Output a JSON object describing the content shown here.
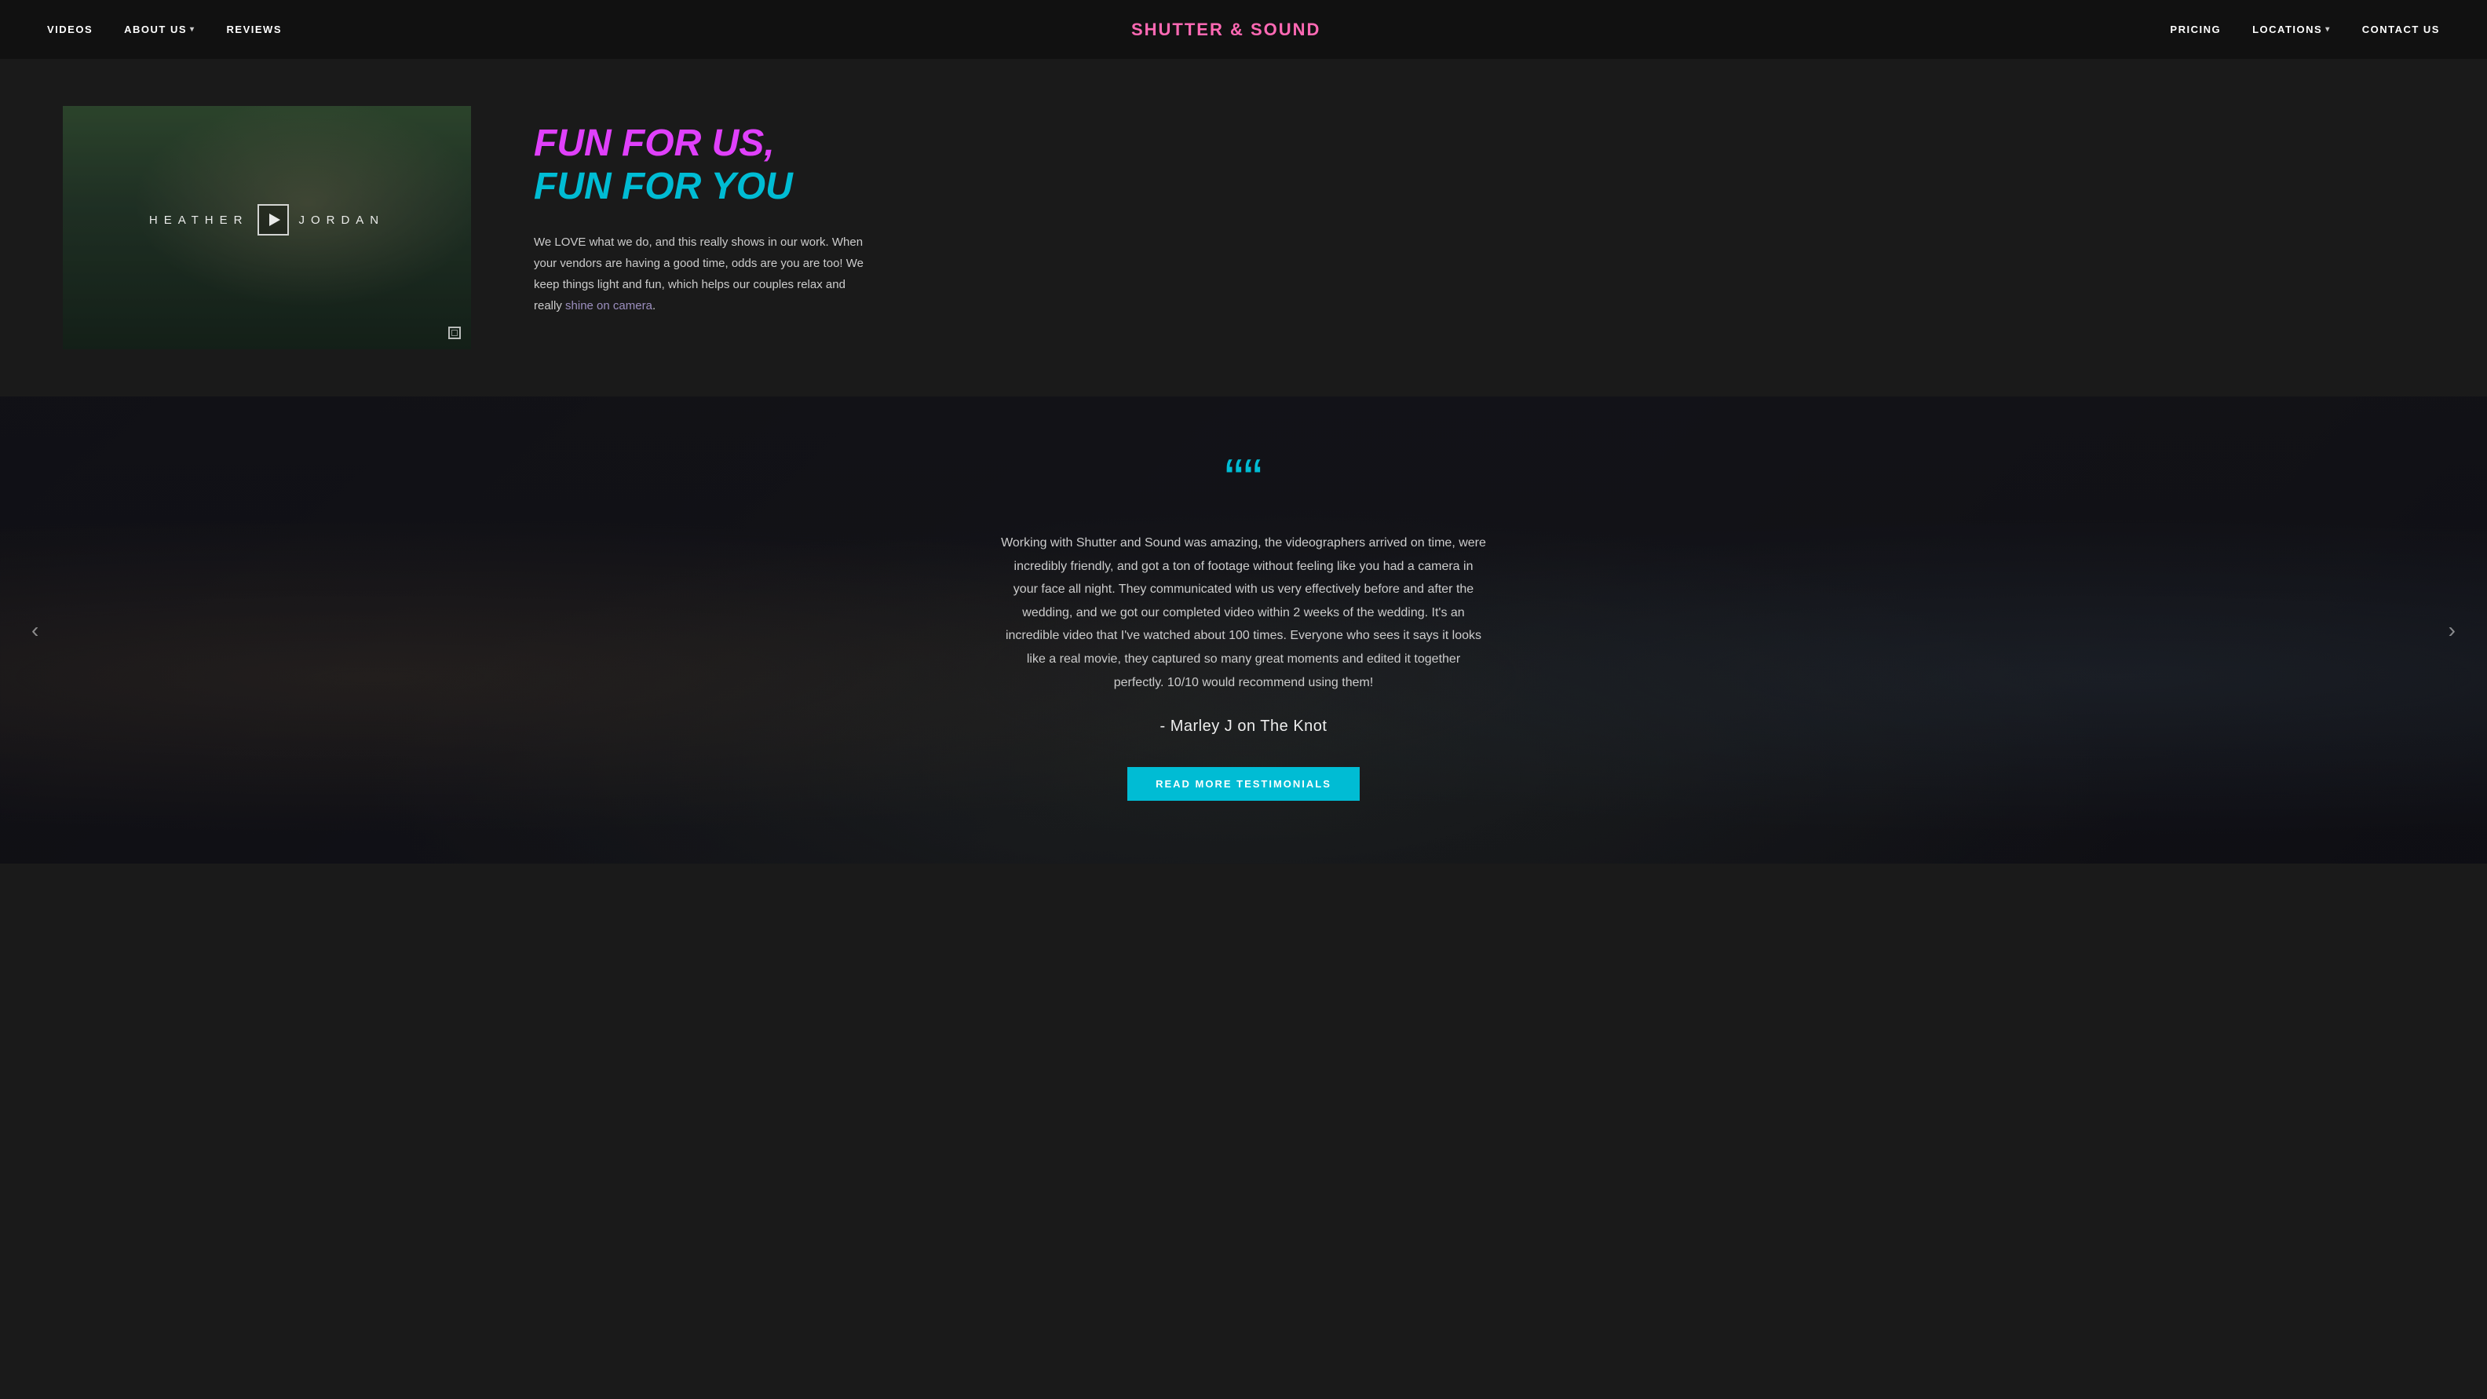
{
  "navbar": {
    "logo": {
      "part1": "SHUTTER",
      "amp": " & ",
      "part2": "SOUND"
    },
    "nav_left": [
      {
        "id": "videos",
        "label": "VIDEOS",
        "has_dropdown": false
      },
      {
        "id": "about",
        "label": "ABOUT US",
        "has_dropdown": true
      },
      {
        "id": "reviews",
        "label": "REVIEWS",
        "has_dropdown": false
      }
    ],
    "nav_right": [
      {
        "id": "pricing",
        "label": "PRICING",
        "has_dropdown": false
      },
      {
        "id": "locations",
        "label": "LOCATIONS",
        "has_dropdown": true
      },
      {
        "id": "contact",
        "label": "CONTACT US",
        "has_dropdown": false
      }
    ]
  },
  "main_section": {
    "video": {
      "title_left": "HEATHER",
      "title_right": "JORDAN"
    },
    "heading": {
      "line1": "FUN FOR US,",
      "line2": "FUN FOR YOU"
    },
    "description": "We LOVE what we do, and this really shows in our work. When your vendors are having a good time, odds are you are too! We keep things light and fun, which helps our couples relax and really",
    "description_link_text": "shine on camera",
    "description_end": "."
  },
  "testimonial_section": {
    "quote_icon": "““",
    "testimonial_text": "Working with Shutter and Sound was amazing, the videographers arrived on time, were incredibly friendly, and got a ton of footage without feeling like you had a camera in your face all night. They communicated with us very effectively before and after the wedding, and we got our completed video within 2 weeks of the wedding. It's an incredible video that I've watched about 100 times. Everyone who sees it says it looks like a real movie, they captured so many great moments and edited it together perfectly. 10/10 would recommend using them!",
    "author": "- Marley J on The Knot",
    "button_label": "READ MORE TESTIMONIALS",
    "arrow_left": "‹",
    "arrow_right": "›"
  },
  "colors": {
    "accent_cyan": "#00bcd4",
    "accent_pink": "#e040fb",
    "accent_purple": "#9c8fbf",
    "text_light": "#ccc",
    "bg_dark": "#1a1a1a",
    "navbar_bg": "#111"
  }
}
